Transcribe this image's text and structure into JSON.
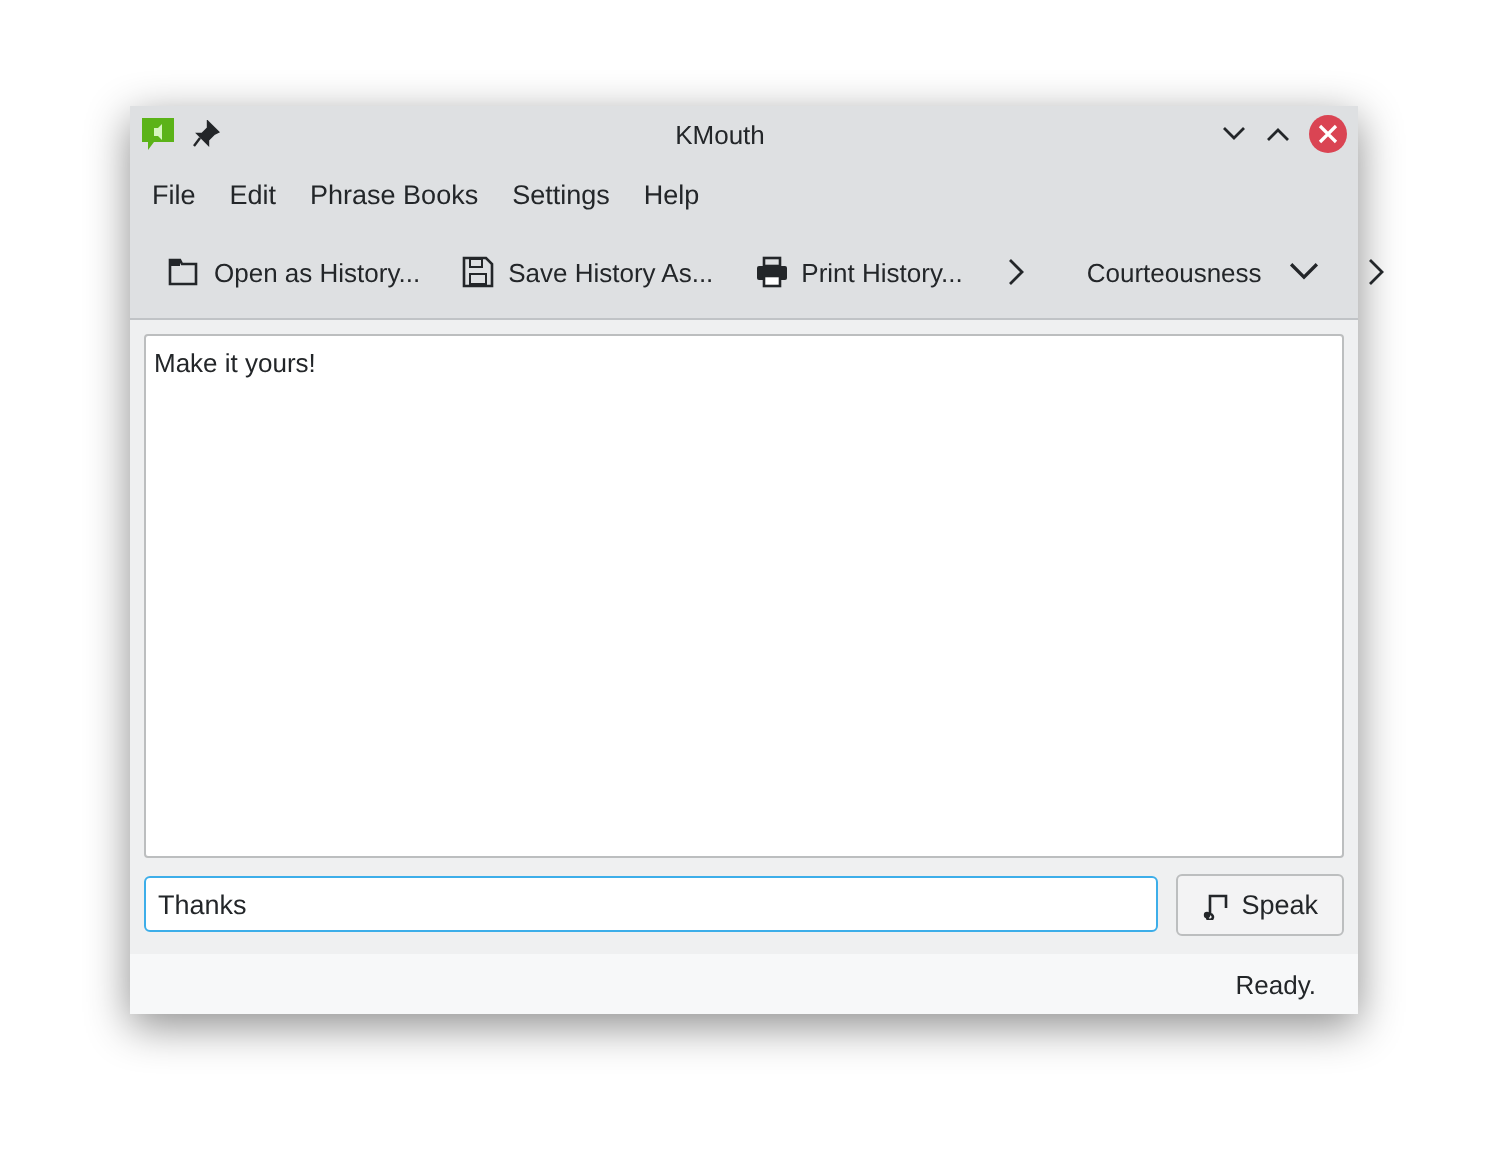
{
  "window": {
    "title": "KMouth"
  },
  "menu": [
    "File",
    "Edit",
    "Phrase Books",
    "Settings",
    "Help"
  ],
  "toolbar": [
    {
      "kind": "action",
      "label": "Open as History..."
    },
    {
      "kind": "action",
      "label": "Save History As..."
    },
    {
      "kind": "action",
      "label": "Print History..."
    },
    {
      "kind": "overflow"
    },
    {
      "kind": "combo",
      "label": "Courteousness"
    },
    {
      "kind": "overflow"
    }
  ],
  "history": {
    "text": "Make it yours!"
  },
  "input": {
    "value": "Thanks"
  },
  "speak_button": {
    "label": "Speak"
  },
  "status_bar": {
    "text": "Ready."
  }
}
